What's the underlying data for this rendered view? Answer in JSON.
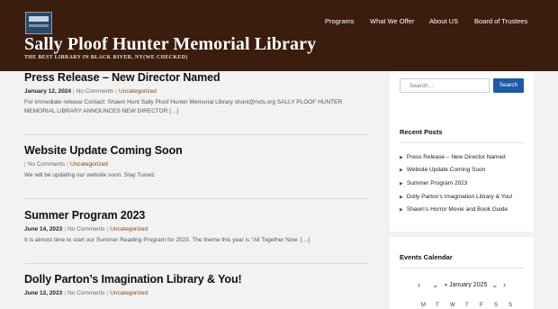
{
  "header": {
    "site_title": "Sally Ploof Hunter Memorial Library",
    "tagline": "THE BEST LIBRARY IN BLACK RIVER, NY(WE CHECKED)",
    "nav": [
      "Programs",
      "What We Offer",
      "About US",
      "Board of Trustees"
    ]
  },
  "posts": [
    {
      "title": "Press Release – New Director Named",
      "date": "January 12, 2024",
      "comments": "No Comments",
      "category": "Uncategorized",
      "excerpt": "For immediate release Contact: Shawn Hunt Sally Ploof Hunter Memorial Library shunt@ncls.org SALLY PLOOF HUNTER MEMORIAL LIBRARY ANNOUNCES NEW DIRECTOR […]"
    },
    {
      "title": "Website Update Coming Soon",
      "date": "",
      "comments": "No Comments",
      "category": "Uncategorized",
      "excerpt": "We will be updating our website soon. Stay Tuned."
    },
    {
      "title": "Summer Program 2023",
      "date": "June 14, 2023",
      "comments": "No Comments",
      "category": "Uncategorized",
      "excerpt": "It is almost time to start our Summer Reading Program for 2023. The theme this year is “All Together Now: […]"
    },
    {
      "title": "Dolly Parton’s Imagination Library & You!",
      "date": "June 12, 2023",
      "comments": "No Comments",
      "category": "Uncategorized",
      "excerpt": ""
    }
  ],
  "sidebar": {
    "search_placeholder": "Search...",
    "search_button": "Search",
    "recent_title": "Recent Posts",
    "recent_posts": [
      "Press Release – New Director Named",
      "Website Update Coming Soon",
      "Summer Program 2023",
      "Dolly Parton’s Imagination Library & You!",
      "Shawn’s Horror Movie and Book Guide"
    ],
    "events_title": "Events Calendar",
    "calendar_month": "January 2025",
    "weekdays": [
      "M",
      "T",
      "W",
      "T",
      "F",
      "S",
      "S"
    ]
  },
  "icons": {
    "prev": "chevron-left-icon",
    "next": "chevron-right-icon",
    "bullet": "triangle-right-icon"
  },
  "colors": {
    "header_bg": "#3a1d0d",
    "accent_link": "#8a4510",
    "button": "#1d5aa7"
  }
}
